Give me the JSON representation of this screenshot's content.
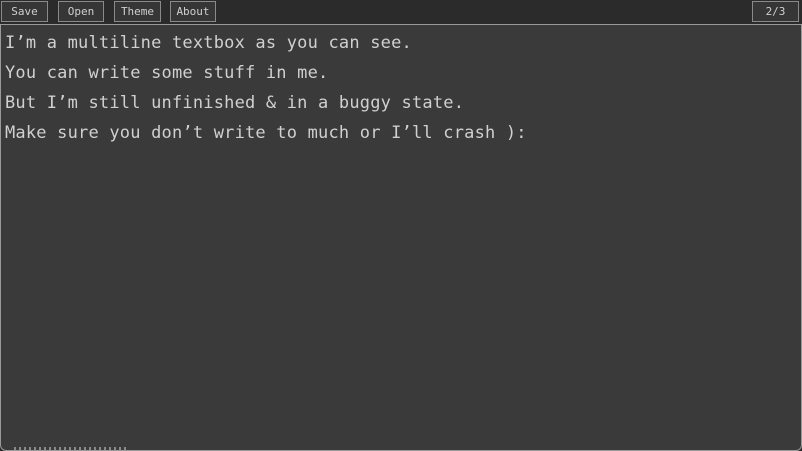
{
  "toolbar": {
    "save_label": "Save",
    "open_label": "Open",
    "theme_label": "Theme",
    "about_label": "About",
    "page_indicator": "2/3"
  },
  "editor": {
    "lines": [
      "I’m a multiline textbox as you can see.",
      "You can write some stuff in me.",
      "But I’m still unfinished & in a buggy state.",
      "Make sure you don’t write to much or I’ll crash ):"
    ]
  }
}
